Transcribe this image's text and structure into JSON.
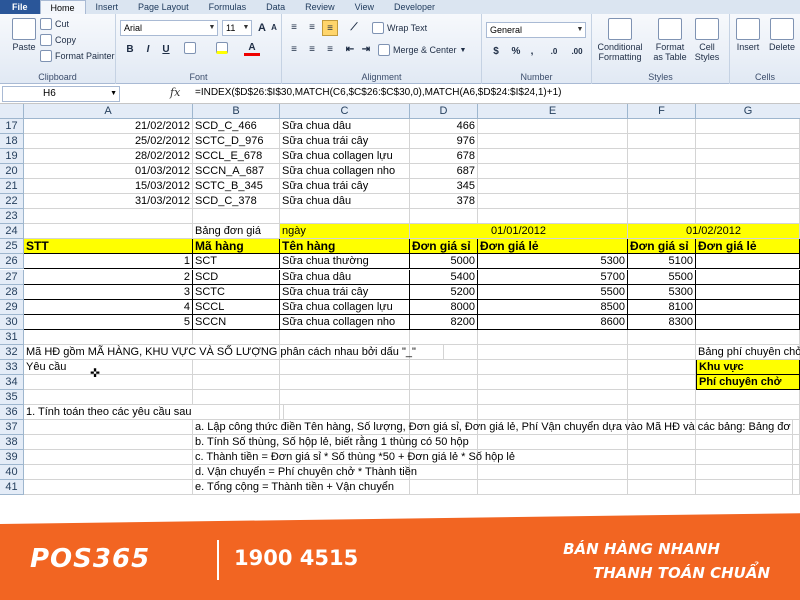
{
  "ribbon_tabs": [
    "File",
    "Home",
    "Insert",
    "Page Layout",
    "Formulas",
    "Data",
    "Review",
    "View",
    "Developer"
  ],
  "clipboard": {
    "paste": "Paste",
    "cut": "Cut",
    "copy": "Copy",
    "format_painter": "Format Painter",
    "label": "Clipboard"
  },
  "font": {
    "name": "Arial",
    "size": "11",
    "label": "Font",
    "bold": "B",
    "italic": "I",
    "underline": "U",
    "grow": "A",
    "shrink": "A",
    "font_color_glyph": "A"
  },
  "alignment": {
    "wrap_text": "Wrap Text",
    "merge_center": "Merge & Center",
    "label": "Alignment"
  },
  "number": {
    "format": "General",
    "label": "Number",
    "currency": "$",
    "percent": "%",
    "comma": ",",
    "inc_dec": ".0",
    "dec_dec": ".00"
  },
  "styles": {
    "conditional": "Conditional\nFormatting",
    "format_table": "Format\nas Table",
    "cell_styles": "Cell\nStyles",
    "label": "Styles"
  },
  "cells": {
    "insert": "Insert",
    "delete": "Delete",
    "label": "Cells"
  },
  "formula_bar": {
    "name_box": "H6",
    "fx": "fx",
    "formula": "=INDEX($D$26:$I$30,MATCH(C6,$C$26:$C$30,0),MATCH(A6,$D$24:$I$24,1)+1)"
  },
  "columns": [
    "A",
    "B",
    "C",
    "D",
    "E",
    "F",
    "G"
  ],
  "rows": [
    {
      "n": "17",
      "a": "21/02/2012",
      "b": "SCD_C_466",
      "c": "Sữa chua dâu",
      "d": "466"
    },
    {
      "n": "18",
      "a": "25/02/2012",
      "b": "SCTC_D_976",
      "c": "Sữa chua trái cây",
      "d": "976"
    },
    {
      "n": "19",
      "a": "28/02/2012",
      "b": "SCCL_E_678",
      "c": "Sữa chua collagen lựu",
      "d": "678"
    },
    {
      "n": "20",
      "a": "01/03/2012",
      "b": "SCCN_A_687",
      "c": "Sữa chua collagen nho",
      "d": "687"
    },
    {
      "n": "21",
      "a": "15/03/2012",
      "b": "SCTC_B_345",
      "c": "Sữa chua trái cây",
      "d": "345"
    },
    {
      "n": "22",
      "a": "31/03/2012",
      "b": "SCD_C_378",
      "c": "Sữa chua dâu",
      "d": "378"
    }
  ],
  "row23": "23",
  "row24": {
    "n": "24",
    "b": "Bảng đơn giá",
    "c": "ngày",
    "de": "01/01/2012",
    "fg": "01/02/2012"
  },
  "row25": {
    "n": "25",
    "a": "STT",
    "b": "Mã hàng",
    "c": "Tên hàng",
    "d": "Đơn giá sỉ",
    "e": "Đơn giá lẻ",
    "f": "Đơn giá sỉ",
    "g": "Đơn giá lẻ"
  },
  "price_rows": [
    {
      "n": "26",
      "a": "1",
      "b": "SCT",
      "c": "Sữa chua thường",
      "d": "5000",
      "e": "5300",
      "f": "5100"
    },
    {
      "n": "27",
      "a": "2",
      "b": "SCD",
      "c": "Sữa chua dâu",
      "d": "5400",
      "e": "5700",
      "f": "5500"
    },
    {
      "n": "28",
      "a": "3",
      "b": "SCTC",
      "c": "Sữa chua trái cây",
      "d": "5200",
      "e": "5500",
      "f": "5300"
    },
    {
      "n": "29",
      "a": "4",
      "b": "SCCL",
      "c": "Sữa chua collagen lựu",
      "d": "8000",
      "e": "8500",
      "f": "8100"
    },
    {
      "n": "30",
      "a": "5",
      "b": "SCCN",
      "c": "Sữa chua collagen nho",
      "d": "8200",
      "e": "8600",
      "f": "8300"
    }
  ],
  "row31": "31",
  "row32": {
    "n": "32",
    "a": "Mã HĐ gồm MÃ HÀNG, KHU VỰC VÀ SỐ LƯỢNG phân cách nhau bởi dấu \"_\"",
    "g": "Bảng phí chuyên chở"
  },
  "row33": {
    "n": "33",
    "a": "Yêu cầu",
    "g": "Khu vực"
  },
  "row34": {
    "n": "34",
    "g": "Phí chuyên chở"
  },
  "row35": "35",
  "row36": {
    "n": "36",
    "a": "1. Tính toán theo các yêu cầu sau"
  },
  "row37": {
    "n": "37",
    "b": "a. Lập công thức điền Tên hàng, Số lượng, Đơn giá sỉ, Đơn giá lẻ, Phí Vận chuyển dựa vào Mã HĐ và các bảng: Bảng đơ"
  },
  "row38": {
    "n": "38",
    "b": "b. Tính Số thùng, Số hộp lẻ, biết rằng 1 thùng có 50 hộp"
  },
  "row39": {
    "n": "39",
    "b": "c. Thành tiền = Đơn giá sỉ * Số thùng *50 + Đơn giá lẻ * Số hộp lẻ"
  },
  "row40": {
    "n": "40",
    "b": "d. Vận chuyển = Phí chuyên chở * Thành tiền"
  },
  "row41": {
    "n": "41",
    "b": "e. Tổng cộng = Thành tiền + Vận chuyển"
  },
  "banner": {
    "logo": "POS365",
    "hotline": "1900 4515",
    "slogan1": "BÁN HÀNG NHANH",
    "slogan2": "THANH TOÁN CHUẨN"
  },
  "colors": {
    "highlight": "#ffff00",
    "banner": "#f26522",
    "file_tab": "#2a5699"
  }
}
